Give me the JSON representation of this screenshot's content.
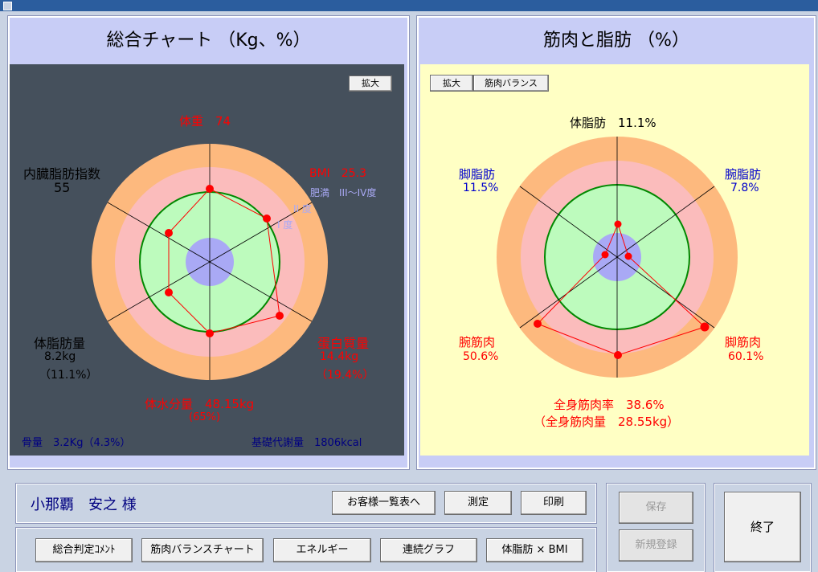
{
  "left_panel": {
    "title": "総合チャート （Kg、%）",
    "zoom_button": "拡大",
    "labels": {
      "weight": "体重　74",
      "bmi": "BMI　25.3",
      "obesity_main": "肥満　III～IV度",
      "obesity_ii": "II 度",
      "obesity_i": "I 度",
      "visceral": "内臓脂肪指数",
      "visceral_value": "55",
      "body_fat": "体脂肪量",
      "body_fat_kg": "8.2kg",
      "body_fat_pct": "（11.1%）",
      "protein": "蛋白質量",
      "protein_kg": "14.4kg",
      "protein_pct": "（19.4%）",
      "water": "体水分量　48.15kg",
      "water_pct": "(65%)",
      "bone": "骨量　3.2Kg（4.3%）",
      "bmr": "基礎代謝量　1806kcal"
    }
  },
  "right_panel": {
    "title": "筋肉と脂肪 （%）",
    "zoom_button": "拡大",
    "balance_button": "筋肉バランス",
    "labels": {
      "body_fat": "体脂肪　11.1%",
      "leg_fat": "脚脂肪",
      "leg_fat_val": "11.5%",
      "arm_fat": "腕脂肪",
      "arm_fat_val": "7.8%",
      "arm_muscle": "腕筋肉",
      "arm_muscle_val": "50.6%",
      "leg_muscle": "脚筋肉",
      "leg_muscle_val": "60.1%",
      "total_muscle_rate": "全身筋肉率　38.6%",
      "total_muscle_mass": "（全身筋肉量　28.55kg）"
    }
  },
  "customer": {
    "name": "小那覇　安之 様"
  },
  "buttons": {
    "customer_list": "お客様一覧表へ",
    "measure": "測定",
    "print": "印刷",
    "save": "保存",
    "new_register": "新規登録",
    "exit": "終了",
    "general_comment": "総合判定ｺﾒﾝﾄ",
    "muscle_balance_chart": "筋肉バランスチャート",
    "energy": "エネルギー",
    "continuous_graph": "連続グラフ",
    "fat_bmi": "体脂肪 × BMI"
  },
  "colors": {
    "outer_ring": "#fdb97e",
    "mid_ring": "#fbbcbc",
    "inner_disc": "#bdfbbd",
    "inner_ring_line": "#008800",
    "core": "#a9a9f5",
    "data_line": "#ff0000",
    "label_red": "#ff0000",
    "label_blue": "#0000cc",
    "label_navy": "#000080"
  }
}
